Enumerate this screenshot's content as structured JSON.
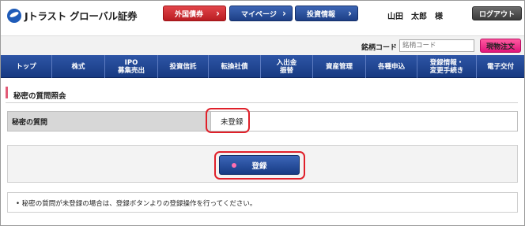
{
  "header": {
    "logo_text": "Jトラスト グローバル証券",
    "buttons": [
      {
        "label": "外国債券",
        "color": "#c8262b"
      },
      {
        "label": "マイページ",
        "color": "#23478f"
      },
      {
        "label": "投資情報",
        "color": "#23478f"
      }
    ],
    "user_label": "山田　太郎　様",
    "logout_label": "ログアウト"
  },
  "search": {
    "label": "銘柄コード",
    "placeholder": "銘柄コード",
    "quote_button": "現物注文"
  },
  "nav": {
    "items": [
      {
        "label": "トップ"
      },
      {
        "label": "株式"
      },
      {
        "label": "IPO\n募集売出"
      },
      {
        "label": "投資信託"
      },
      {
        "label": "転換社債"
      },
      {
        "label": "入出金\n振替"
      },
      {
        "label": "資産管理"
      },
      {
        "label": "各種申込"
      },
      {
        "label": "登録情報・\n変更手続き"
      },
      {
        "label": "電子交付"
      }
    ]
  },
  "page": {
    "title": "秘密の質問照会",
    "question_label": "秘密の質問",
    "question_value": "未登録",
    "register_button": "登録",
    "note": "• 秘密の質問が未登録の場合は、登録ボタンよりの登録操作を行ってください。"
  },
  "colors": {
    "nav_bg": "#1f4595",
    "accent_pink": "#e8177e",
    "highlight_red": "#e0202a"
  }
}
